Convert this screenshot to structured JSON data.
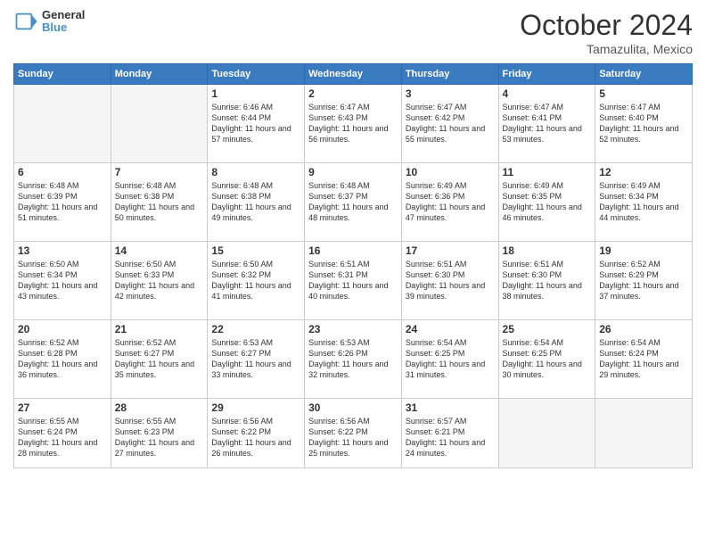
{
  "header": {
    "logo_line1": "General",
    "logo_line2": "Blue",
    "month": "October 2024",
    "location": "Tamazulita, Mexico"
  },
  "weekdays": [
    "Sunday",
    "Monday",
    "Tuesday",
    "Wednesday",
    "Thursday",
    "Friday",
    "Saturday"
  ],
  "weeks": [
    [
      {
        "day": "",
        "info": ""
      },
      {
        "day": "",
        "info": ""
      },
      {
        "day": "1",
        "info": "Sunrise: 6:46 AM\nSunset: 6:44 PM\nDaylight: 11 hours and 57 minutes."
      },
      {
        "day": "2",
        "info": "Sunrise: 6:47 AM\nSunset: 6:43 PM\nDaylight: 11 hours and 56 minutes."
      },
      {
        "day": "3",
        "info": "Sunrise: 6:47 AM\nSunset: 6:42 PM\nDaylight: 11 hours and 55 minutes."
      },
      {
        "day": "4",
        "info": "Sunrise: 6:47 AM\nSunset: 6:41 PM\nDaylight: 11 hours and 53 minutes."
      },
      {
        "day": "5",
        "info": "Sunrise: 6:47 AM\nSunset: 6:40 PM\nDaylight: 11 hours and 52 minutes."
      }
    ],
    [
      {
        "day": "6",
        "info": "Sunrise: 6:48 AM\nSunset: 6:39 PM\nDaylight: 11 hours and 51 minutes."
      },
      {
        "day": "7",
        "info": "Sunrise: 6:48 AM\nSunset: 6:38 PM\nDaylight: 11 hours and 50 minutes."
      },
      {
        "day": "8",
        "info": "Sunrise: 6:48 AM\nSunset: 6:38 PM\nDaylight: 11 hours and 49 minutes."
      },
      {
        "day": "9",
        "info": "Sunrise: 6:48 AM\nSunset: 6:37 PM\nDaylight: 11 hours and 48 minutes."
      },
      {
        "day": "10",
        "info": "Sunrise: 6:49 AM\nSunset: 6:36 PM\nDaylight: 11 hours and 47 minutes."
      },
      {
        "day": "11",
        "info": "Sunrise: 6:49 AM\nSunset: 6:35 PM\nDaylight: 11 hours and 46 minutes."
      },
      {
        "day": "12",
        "info": "Sunrise: 6:49 AM\nSunset: 6:34 PM\nDaylight: 11 hours and 44 minutes."
      }
    ],
    [
      {
        "day": "13",
        "info": "Sunrise: 6:50 AM\nSunset: 6:34 PM\nDaylight: 11 hours and 43 minutes."
      },
      {
        "day": "14",
        "info": "Sunrise: 6:50 AM\nSunset: 6:33 PM\nDaylight: 11 hours and 42 minutes."
      },
      {
        "day": "15",
        "info": "Sunrise: 6:50 AM\nSunset: 6:32 PM\nDaylight: 11 hours and 41 minutes."
      },
      {
        "day": "16",
        "info": "Sunrise: 6:51 AM\nSunset: 6:31 PM\nDaylight: 11 hours and 40 minutes."
      },
      {
        "day": "17",
        "info": "Sunrise: 6:51 AM\nSunset: 6:30 PM\nDaylight: 11 hours and 39 minutes."
      },
      {
        "day": "18",
        "info": "Sunrise: 6:51 AM\nSunset: 6:30 PM\nDaylight: 11 hours and 38 minutes."
      },
      {
        "day": "19",
        "info": "Sunrise: 6:52 AM\nSunset: 6:29 PM\nDaylight: 11 hours and 37 minutes."
      }
    ],
    [
      {
        "day": "20",
        "info": "Sunrise: 6:52 AM\nSunset: 6:28 PM\nDaylight: 11 hours and 36 minutes."
      },
      {
        "day": "21",
        "info": "Sunrise: 6:52 AM\nSunset: 6:27 PM\nDaylight: 11 hours and 35 minutes."
      },
      {
        "day": "22",
        "info": "Sunrise: 6:53 AM\nSunset: 6:27 PM\nDaylight: 11 hours and 33 minutes."
      },
      {
        "day": "23",
        "info": "Sunrise: 6:53 AM\nSunset: 6:26 PM\nDaylight: 11 hours and 32 minutes."
      },
      {
        "day": "24",
        "info": "Sunrise: 6:54 AM\nSunset: 6:25 PM\nDaylight: 11 hours and 31 minutes."
      },
      {
        "day": "25",
        "info": "Sunrise: 6:54 AM\nSunset: 6:25 PM\nDaylight: 11 hours and 30 minutes."
      },
      {
        "day": "26",
        "info": "Sunrise: 6:54 AM\nSunset: 6:24 PM\nDaylight: 11 hours and 29 minutes."
      }
    ],
    [
      {
        "day": "27",
        "info": "Sunrise: 6:55 AM\nSunset: 6:24 PM\nDaylight: 11 hours and 28 minutes."
      },
      {
        "day": "28",
        "info": "Sunrise: 6:55 AM\nSunset: 6:23 PM\nDaylight: 11 hours and 27 minutes."
      },
      {
        "day": "29",
        "info": "Sunrise: 6:56 AM\nSunset: 6:22 PM\nDaylight: 11 hours and 26 minutes."
      },
      {
        "day": "30",
        "info": "Sunrise: 6:56 AM\nSunset: 6:22 PM\nDaylight: 11 hours and 25 minutes."
      },
      {
        "day": "31",
        "info": "Sunrise: 6:57 AM\nSunset: 6:21 PM\nDaylight: 11 hours and 24 minutes."
      },
      {
        "day": "",
        "info": ""
      },
      {
        "day": "",
        "info": ""
      }
    ]
  ]
}
